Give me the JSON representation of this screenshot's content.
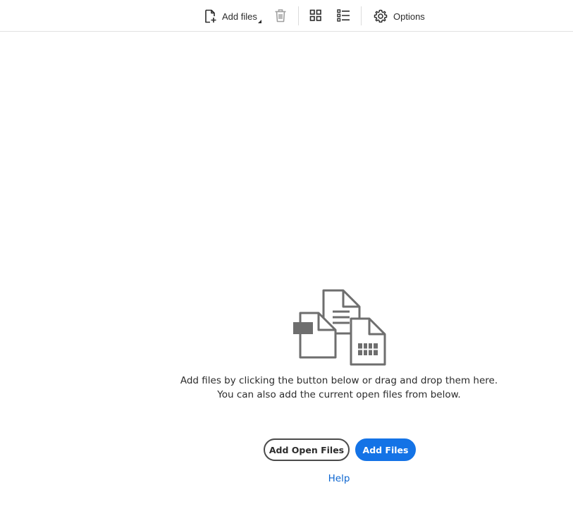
{
  "toolbar": {
    "add_files_label": "Add files",
    "options_label": "Options",
    "icons": {
      "add_files": "add-file-icon",
      "delete": "trash-icon",
      "grid_view": "grid-view-icon",
      "list_view": "list-view-icon",
      "options": "gear-icon"
    }
  },
  "empty_state": {
    "illustration": "files-illustration",
    "line1": "Add files by clicking the button below or drag and drop them here.",
    "line2": "You can also add the current open files from below."
  },
  "actions": {
    "add_open_files_label": "Add Open Files",
    "add_files_label": "Add Files",
    "help_label": "Help"
  },
  "colors": {
    "primary": "#1473e6",
    "link": "#0d66d0",
    "icon": "#4b4b4b",
    "icon_disabled": "#a0a0a0"
  }
}
